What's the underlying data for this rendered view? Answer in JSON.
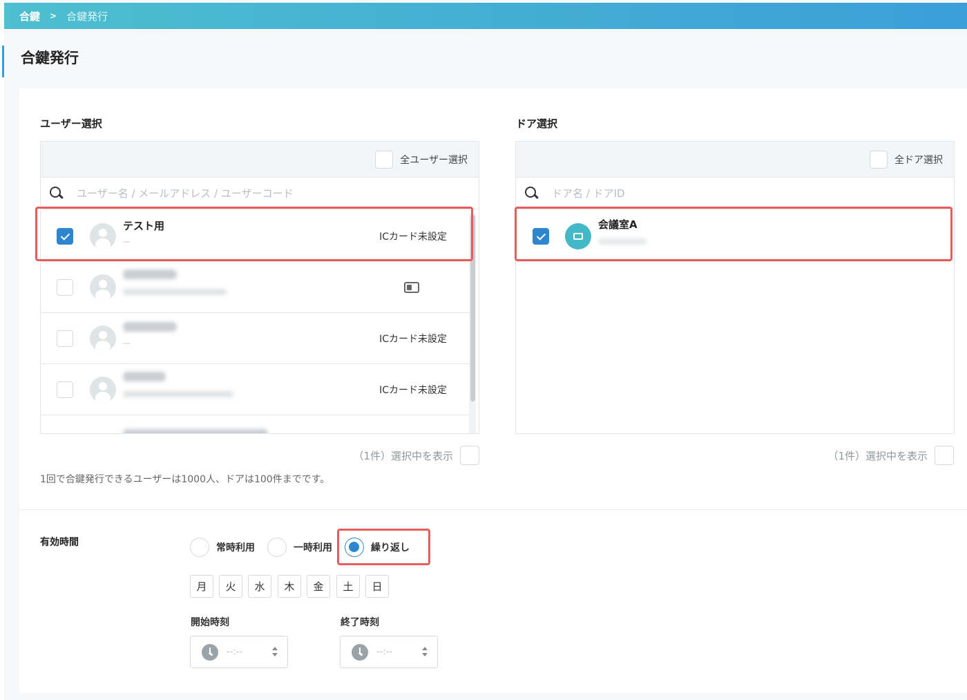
{
  "breadcrumb": {
    "root": "合鍵",
    "separator": ">",
    "current": "合鍵発行"
  },
  "page_title": "合鍵発行",
  "user_section": {
    "label": "ユーザー選択",
    "select_all_label": "全ユーザー選択",
    "search_placeholder": "ユーザー名 / メールアドレス / ユーザーコード",
    "rows": [
      {
        "name": "テスト用",
        "sub": "—",
        "status": "ICカード未設定",
        "checked": true
      },
      {
        "name": "",
        "sub": "",
        "status": "",
        "checked": false,
        "icon": "ic-card-icon"
      },
      {
        "name": "",
        "sub": "—",
        "status": "ICカード未設定",
        "checked": false
      },
      {
        "name": "",
        "sub": "",
        "status": "ICカード未設定",
        "checked": false
      }
    ],
    "count_label": "（1件）選択中を表示"
  },
  "door_section": {
    "label": "ドア選択",
    "select_all_label": "全ドア選択",
    "search_placeholder": "ドア名 / ドアID",
    "rows": [
      {
        "name": "会議室A",
        "sub": "",
        "checked": true
      }
    ],
    "count_label": "（1件）選択中を表示"
  },
  "limit_note": "1回で合鍵発行できるユーザーは1000人、ドアは100件までです。",
  "validity": {
    "label": "有効時間",
    "options": [
      {
        "label": "常時利用",
        "selected": false
      },
      {
        "label": "一時利用",
        "selected": false
      },
      {
        "label": "繰り返し",
        "selected": true
      }
    ],
    "days": [
      "月",
      "火",
      "水",
      "木",
      "金",
      "土",
      "日"
    ],
    "start_label": "開始時刻",
    "end_label": "終了時刻",
    "start_value": "--:--",
    "end_value": "--:--"
  },
  "colors": {
    "accent": "#2f86d0",
    "header_gradient_start": "#4dbfcf",
    "header_gradient_end": "#3a9fd8",
    "highlight": "#ea5b5b",
    "door_avatar": "#43b8c6"
  }
}
